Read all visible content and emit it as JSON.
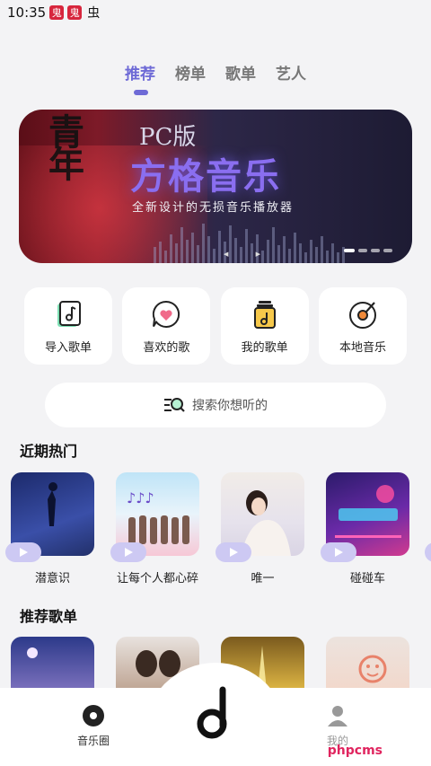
{
  "status": {
    "time": "10:35",
    "badge1": "鬼",
    "badge2": "鬼",
    "icon": "虫"
  },
  "tabs": [
    {
      "label": "推荐",
      "active": true
    },
    {
      "label": "榜单",
      "active": false
    },
    {
      "label": "歌单",
      "active": false
    },
    {
      "label": "艺人",
      "active": false
    }
  ],
  "banner": {
    "pc_label": "PC版",
    "title": "方格音乐",
    "subtitle": "全新设计的无损音乐播放器",
    "calligraphy": "青年",
    "page_count": 4,
    "active_index": 0
  },
  "quick_actions": [
    {
      "label": "导入歌单",
      "icon": "import-playlist-icon"
    },
    {
      "label": "喜欢的歌",
      "icon": "heart-chat-icon"
    },
    {
      "label": "我的歌单",
      "icon": "my-playlist-icon"
    },
    {
      "label": "本地音乐",
      "icon": "vinyl-disc-icon"
    }
  ],
  "search": {
    "placeholder": "搜索你想听的"
  },
  "sections": {
    "hot": "近期热门",
    "recommended": "推荐歌单"
  },
  "hot_songs": [
    {
      "name": "潜意识",
      "colors": [
        "#1c2a6b",
        "#3a4fa8"
      ]
    },
    {
      "name": "让每个人都心碎",
      "colors": [
        "#bfe4f7",
        "#f6c8d6"
      ]
    },
    {
      "name": "唯一",
      "colors": [
        "#f1ece8",
        "#d9d4e4"
      ]
    },
    {
      "name": "碰碰车",
      "colors": [
        "#2b1b6a",
        "#d13a8f"
      ]
    }
  ],
  "recommended": [
    {
      "colors": [
        "#2c3a8a",
        "#8a7ac6"
      ]
    },
    {
      "colors": [
        "#e8e2de",
        "#6b4e3e"
      ]
    },
    {
      "colors": [
        "#7a5a1e",
        "#f0c64a"
      ]
    },
    {
      "colors": [
        "#ece3de",
        "#f3b7a2"
      ]
    }
  ],
  "nav": {
    "left": "音乐圈",
    "right": "我的"
  },
  "watermark": "phpcms",
  "accent": "#6e6ad6"
}
